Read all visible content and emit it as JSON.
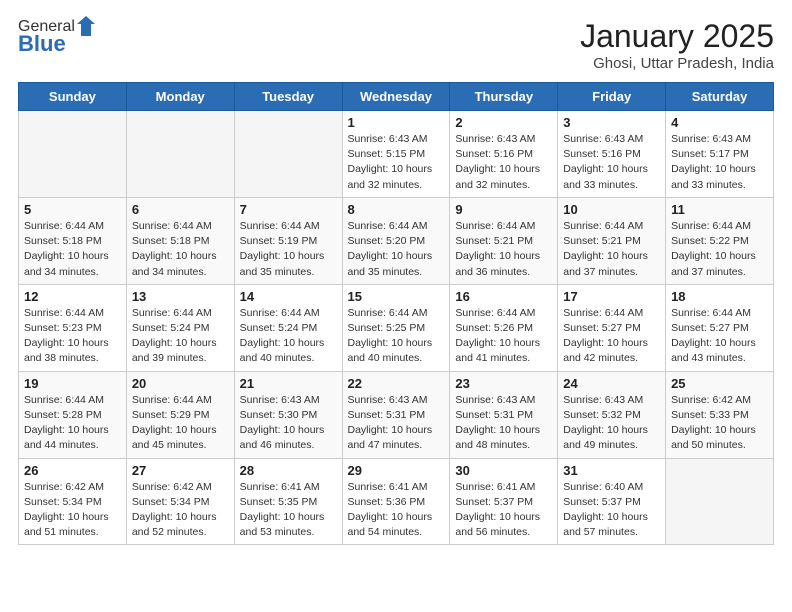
{
  "header": {
    "logo_general": "General",
    "logo_blue": "Blue",
    "month_year": "January 2025",
    "location": "Ghosi, Uttar Pradesh, India"
  },
  "weekdays": [
    "Sunday",
    "Monday",
    "Tuesday",
    "Wednesday",
    "Thursday",
    "Friday",
    "Saturday"
  ],
  "weeks": [
    [
      {
        "day": "",
        "info": ""
      },
      {
        "day": "",
        "info": ""
      },
      {
        "day": "",
        "info": ""
      },
      {
        "day": "1",
        "info": "Sunrise: 6:43 AM\nSunset: 5:15 PM\nDaylight: 10 hours\nand 32 minutes."
      },
      {
        "day": "2",
        "info": "Sunrise: 6:43 AM\nSunset: 5:16 PM\nDaylight: 10 hours\nand 32 minutes."
      },
      {
        "day": "3",
        "info": "Sunrise: 6:43 AM\nSunset: 5:16 PM\nDaylight: 10 hours\nand 33 minutes."
      },
      {
        "day": "4",
        "info": "Sunrise: 6:43 AM\nSunset: 5:17 PM\nDaylight: 10 hours\nand 33 minutes."
      }
    ],
    [
      {
        "day": "5",
        "info": "Sunrise: 6:44 AM\nSunset: 5:18 PM\nDaylight: 10 hours\nand 34 minutes."
      },
      {
        "day": "6",
        "info": "Sunrise: 6:44 AM\nSunset: 5:18 PM\nDaylight: 10 hours\nand 34 minutes."
      },
      {
        "day": "7",
        "info": "Sunrise: 6:44 AM\nSunset: 5:19 PM\nDaylight: 10 hours\nand 35 minutes."
      },
      {
        "day": "8",
        "info": "Sunrise: 6:44 AM\nSunset: 5:20 PM\nDaylight: 10 hours\nand 35 minutes."
      },
      {
        "day": "9",
        "info": "Sunrise: 6:44 AM\nSunset: 5:21 PM\nDaylight: 10 hours\nand 36 minutes."
      },
      {
        "day": "10",
        "info": "Sunrise: 6:44 AM\nSunset: 5:21 PM\nDaylight: 10 hours\nand 37 minutes."
      },
      {
        "day": "11",
        "info": "Sunrise: 6:44 AM\nSunset: 5:22 PM\nDaylight: 10 hours\nand 37 minutes."
      }
    ],
    [
      {
        "day": "12",
        "info": "Sunrise: 6:44 AM\nSunset: 5:23 PM\nDaylight: 10 hours\nand 38 minutes."
      },
      {
        "day": "13",
        "info": "Sunrise: 6:44 AM\nSunset: 5:24 PM\nDaylight: 10 hours\nand 39 minutes."
      },
      {
        "day": "14",
        "info": "Sunrise: 6:44 AM\nSunset: 5:24 PM\nDaylight: 10 hours\nand 40 minutes."
      },
      {
        "day": "15",
        "info": "Sunrise: 6:44 AM\nSunset: 5:25 PM\nDaylight: 10 hours\nand 40 minutes."
      },
      {
        "day": "16",
        "info": "Sunrise: 6:44 AM\nSunset: 5:26 PM\nDaylight: 10 hours\nand 41 minutes."
      },
      {
        "day": "17",
        "info": "Sunrise: 6:44 AM\nSunset: 5:27 PM\nDaylight: 10 hours\nand 42 minutes."
      },
      {
        "day": "18",
        "info": "Sunrise: 6:44 AM\nSunset: 5:27 PM\nDaylight: 10 hours\nand 43 minutes."
      }
    ],
    [
      {
        "day": "19",
        "info": "Sunrise: 6:44 AM\nSunset: 5:28 PM\nDaylight: 10 hours\nand 44 minutes."
      },
      {
        "day": "20",
        "info": "Sunrise: 6:44 AM\nSunset: 5:29 PM\nDaylight: 10 hours\nand 45 minutes."
      },
      {
        "day": "21",
        "info": "Sunrise: 6:43 AM\nSunset: 5:30 PM\nDaylight: 10 hours\nand 46 minutes."
      },
      {
        "day": "22",
        "info": "Sunrise: 6:43 AM\nSunset: 5:31 PM\nDaylight: 10 hours\nand 47 minutes."
      },
      {
        "day": "23",
        "info": "Sunrise: 6:43 AM\nSunset: 5:31 PM\nDaylight: 10 hours\nand 48 minutes."
      },
      {
        "day": "24",
        "info": "Sunrise: 6:43 AM\nSunset: 5:32 PM\nDaylight: 10 hours\nand 49 minutes."
      },
      {
        "day": "25",
        "info": "Sunrise: 6:42 AM\nSunset: 5:33 PM\nDaylight: 10 hours\nand 50 minutes."
      }
    ],
    [
      {
        "day": "26",
        "info": "Sunrise: 6:42 AM\nSunset: 5:34 PM\nDaylight: 10 hours\nand 51 minutes."
      },
      {
        "day": "27",
        "info": "Sunrise: 6:42 AM\nSunset: 5:34 PM\nDaylight: 10 hours\nand 52 minutes."
      },
      {
        "day": "28",
        "info": "Sunrise: 6:41 AM\nSunset: 5:35 PM\nDaylight: 10 hours\nand 53 minutes."
      },
      {
        "day": "29",
        "info": "Sunrise: 6:41 AM\nSunset: 5:36 PM\nDaylight: 10 hours\nand 54 minutes."
      },
      {
        "day": "30",
        "info": "Sunrise: 6:41 AM\nSunset: 5:37 PM\nDaylight: 10 hours\nand 56 minutes."
      },
      {
        "day": "31",
        "info": "Sunrise: 6:40 AM\nSunset: 5:37 PM\nDaylight: 10 hours\nand 57 minutes."
      },
      {
        "day": "",
        "info": ""
      }
    ]
  ]
}
